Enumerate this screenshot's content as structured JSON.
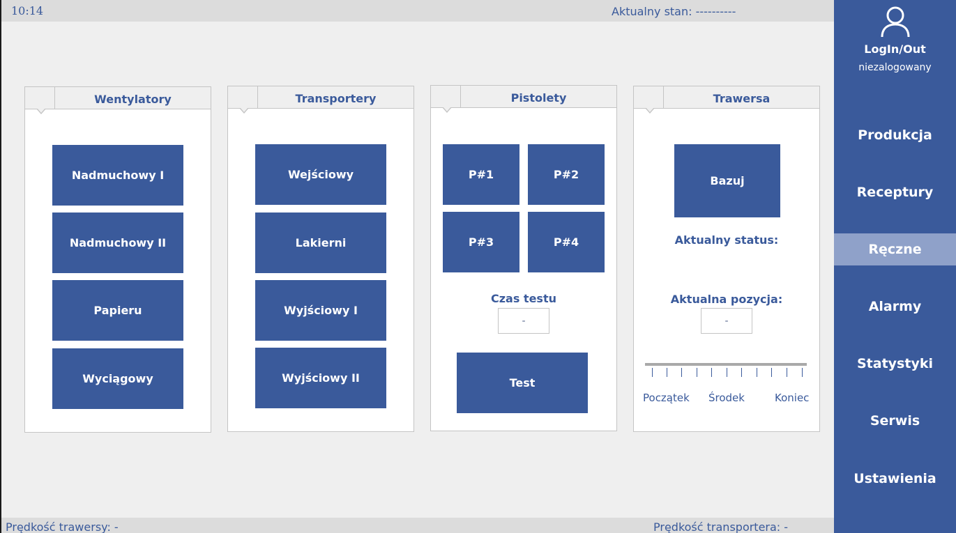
{
  "topbar": {
    "time": "10:14",
    "state": "Aktualny stan: ----------"
  },
  "bottombar": {
    "left": "Prędkość trawersy:  -",
    "right": "Prędkość transportera:  -"
  },
  "sidebar": {
    "login_label": "LogIn/Out",
    "login_status": "niezalogowany",
    "items": [
      {
        "label": "Produkcja"
      },
      {
        "label": "Receptury"
      },
      {
        "label": "Ręczne"
      },
      {
        "label": "Alarmy"
      },
      {
        "label": "Statystyki"
      },
      {
        "label": "Serwis"
      },
      {
        "label": "Ustawienia"
      }
    ],
    "active_item": "Ręczne",
    "accent": "#3a5a9b",
    "active_color": "#8fa1c9"
  },
  "panels": {
    "wentylatory": {
      "title": "Wentylatory",
      "buttons": [
        "Nadmuchowy I",
        "Nadmuchowy II",
        "Papieru",
        "Wyciągowy"
      ]
    },
    "transportery": {
      "title": "Transportery",
      "buttons": [
        "Wejściowy",
        "Lakierni",
        "Wyjściowy I",
        "Wyjściowy II"
      ]
    },
    "pistolety": {
      "title": "Pistolety",
      "buttons": [
        "P#1",
        "P#2",
        "P#3",
        "P#4"
      ],
      "test_time_label": "Czas testu",
      "test_time_value": "-",
      "test_button": "Test"
    },
    "trawersa": {
      "title": "Trawersa",
      "base_button": "Bazuj",
      "status_label": "Aktualny status:",
      "position_label": "Aktualna pozycja:",
      "position_value": "-",
      "scale": {
        "start": "Początek",
        "middle": "Środek",
        "end": "Koniec"
      }
    }
  }
}
